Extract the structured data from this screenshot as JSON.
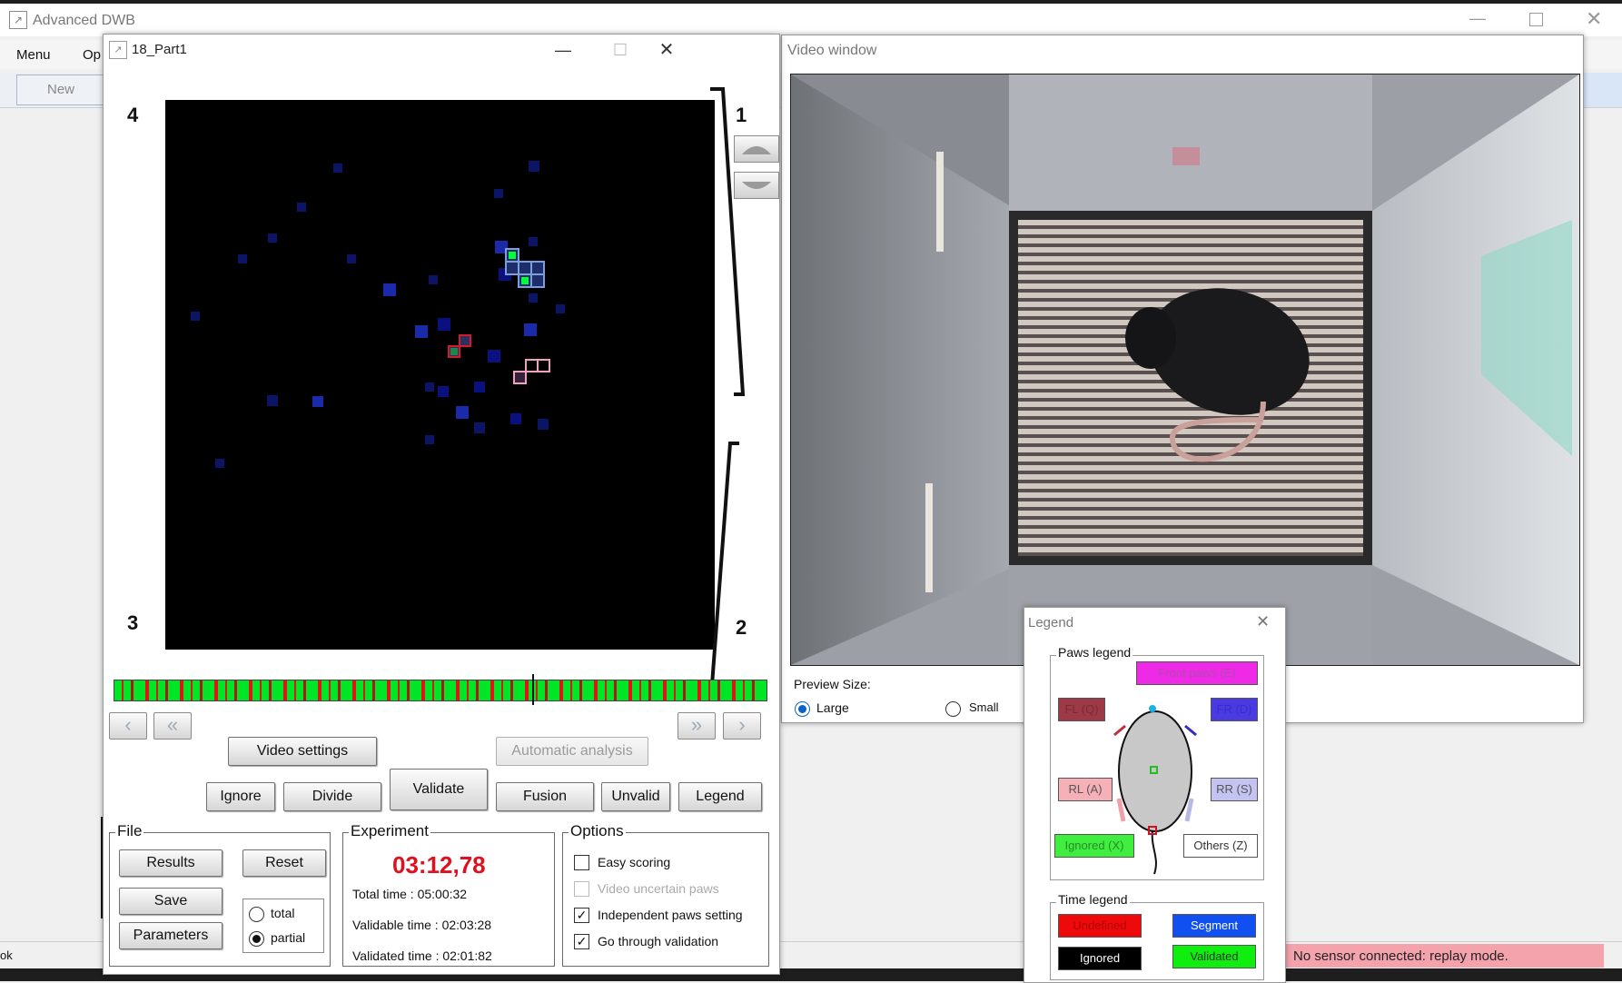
{
  "app": {
    "title": "Advanced DWB",
    "menu": [
      "Menu",
      "Op"
    ],
    "new_label": "New",
    "status_left": "ok",
    "status_message": "No sensor connected: replay mode."
  },
  "part_window": {
    "title": "18_Part1",
    "corners": {
      "tl": "4",
      "tr": "1",
      "bl": "3",
      "br": "2"
    },
    "buttons": {
      "video_settings": "Video settings",
      "automatic_analysis": "Automatic analysis",
      "ignore": "Ignore",
      "divide": "Divide",
      "validate": "Validate",
      "fusion": "Fusion",
      "unvalid": "Unvalid",
      "legend": "Legend"
    },
    "file": {
      "label": "File",
      "results": "Results",
      "reset": "Reset",
      "save": "Save",
      "parameters": "Parameters",
      "total": "total",
      "partial": "partial",
      "selected": "partial"
    },
    "experiment": {
      "label": "Experiment",
      "time": "03:12,78",
      "total_time": "Total time : 05:00:32",
      "validable_time": "Validable time : 02:03:28",
      "validated_time": "Validated time : 02:01:82"
    },
    "options": {
      "label": "Options",
      "easy_scoring": "Easy scoring",
      "video_uncertain": "Video uncertain paws",
      "independent": "Independent paws setting",
      "go_through": "Go through validation"
    },
    "colors": {
      "validated": "#00ff00",
      "undefined": "#ff0000",
      "background": "#000000"
    }
  },
  "video_window": {
    "title": "Video window",
    "preview_size": "Preview Size:",
    "large": "Large",
    "small": "Small",
    "selected": "Large"
  },
  "legend_window": {
    "title": "Legend",
    "paws_legend": "Paws legend",
    "front_paws": "Front paws (E)",
    "fl": "FL (Q)",
    "fr": "FR (D)",
    "rl": "RL (A)",
    "rr": "RR (S)",
    "ignored": "Ignored (X)",
    "others": "Others (Z)",
    "time_legend": "Time legend",
    "undefined": "Undefined",
    "segment": "Segment",
    "ignored_t": "Ignored",
    "validated": "Validated"
  }
}
